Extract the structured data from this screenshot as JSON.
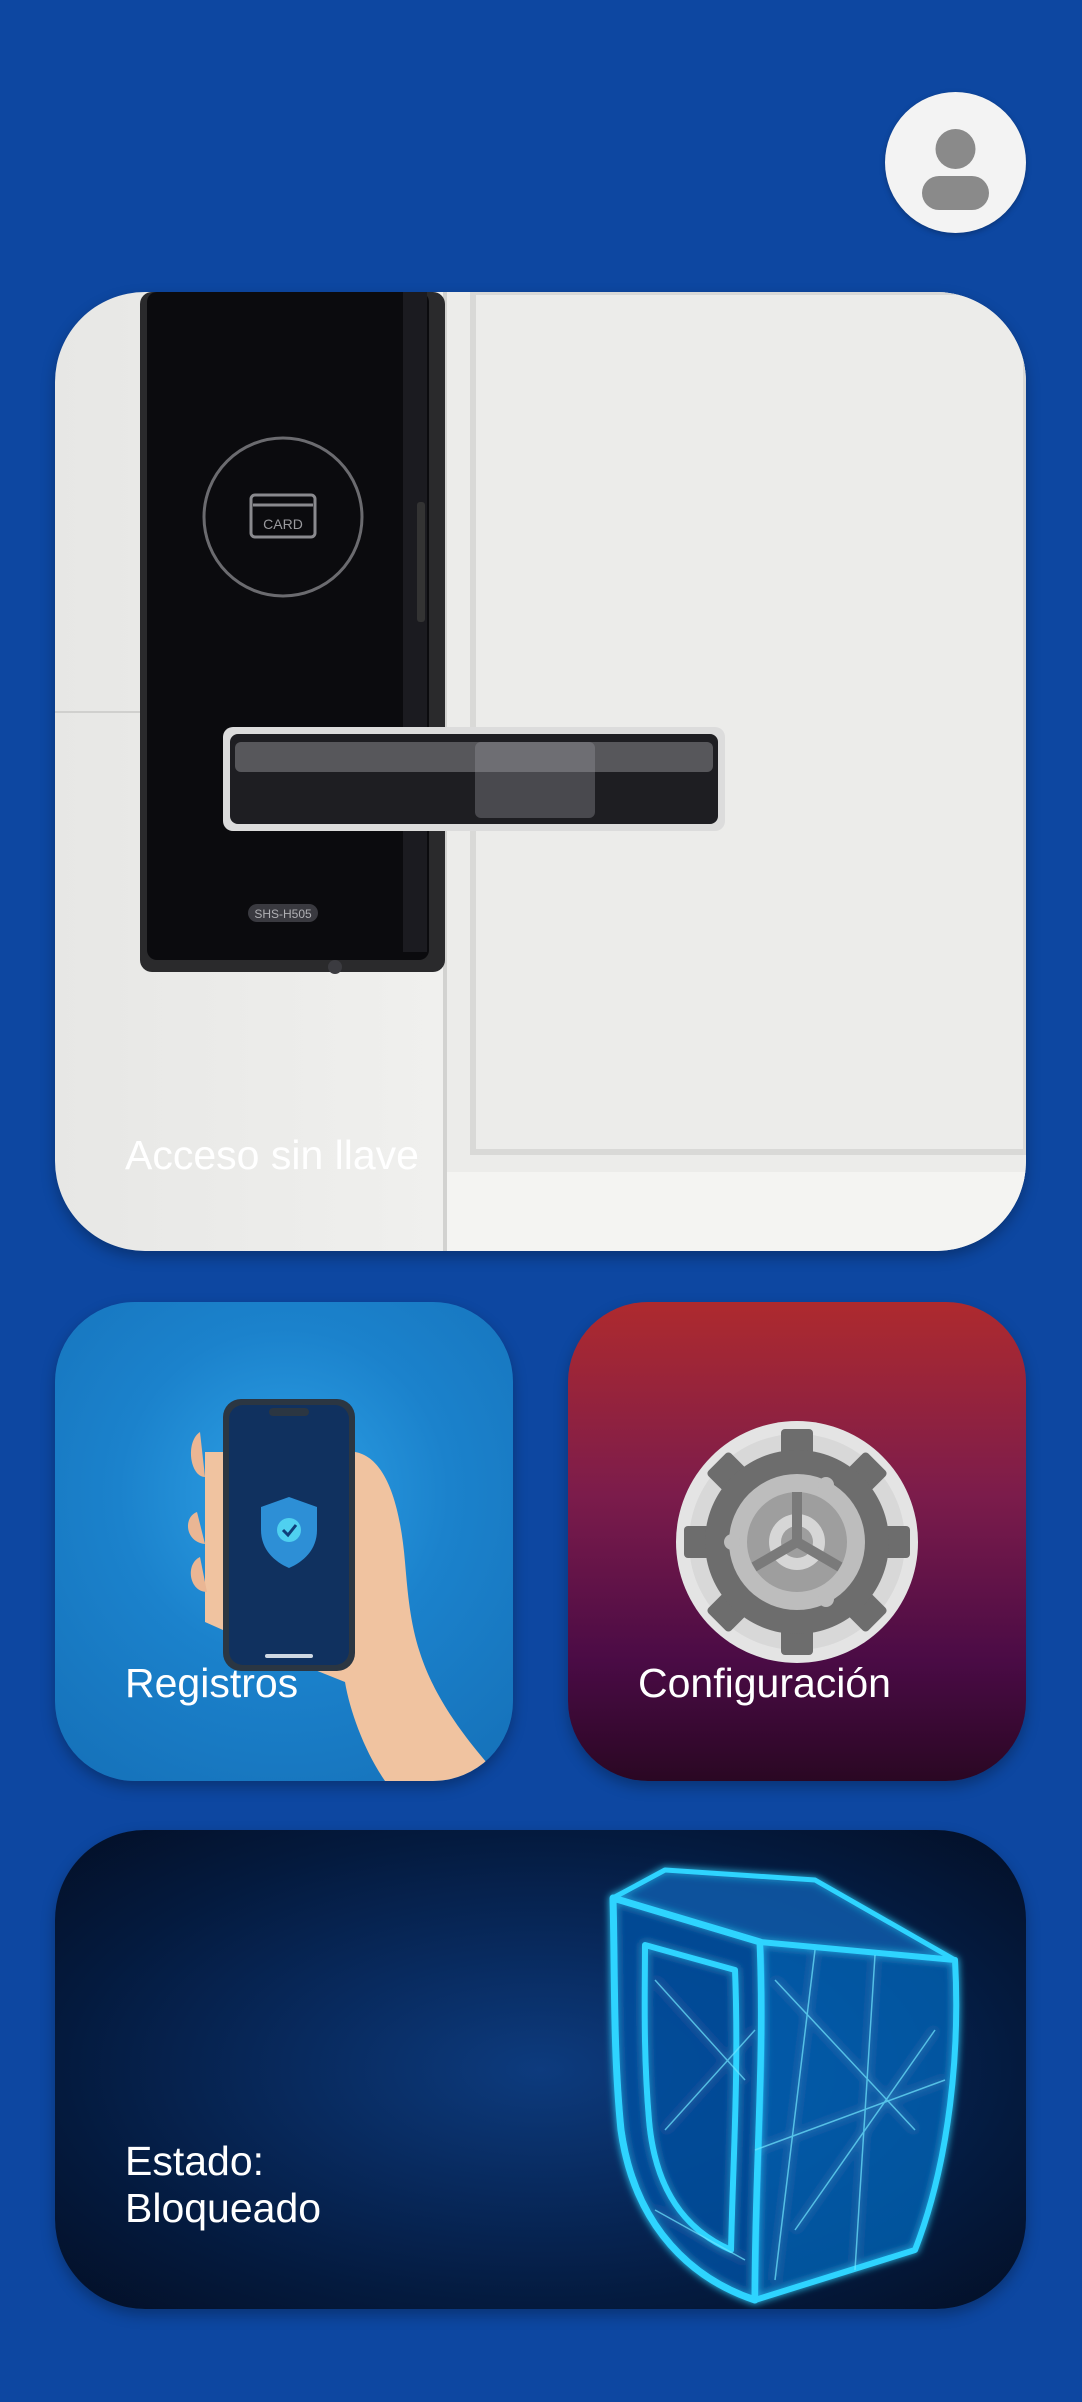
{
  "header": {
    "avatar_icon": "user-icon"
  },
  "cards": {
    "access": {
      "label": "Acceso sin llave",
      "lock_card_text": "CARD",
      "lock_model_text": "SHS-H505"
    },
    "records": {
      "label": "Registros"
    },
    "settings": {
      "label": "Configuración",
      "icon": "gear-icon"
    },
    "status": {
      "label": "Estado:\nBloqueado",
      "icon": "shield-icon"
    }
  },
  "colors": {
    "background": "#0d47a1",
    "label_text": "#ffffff"
  }
}
